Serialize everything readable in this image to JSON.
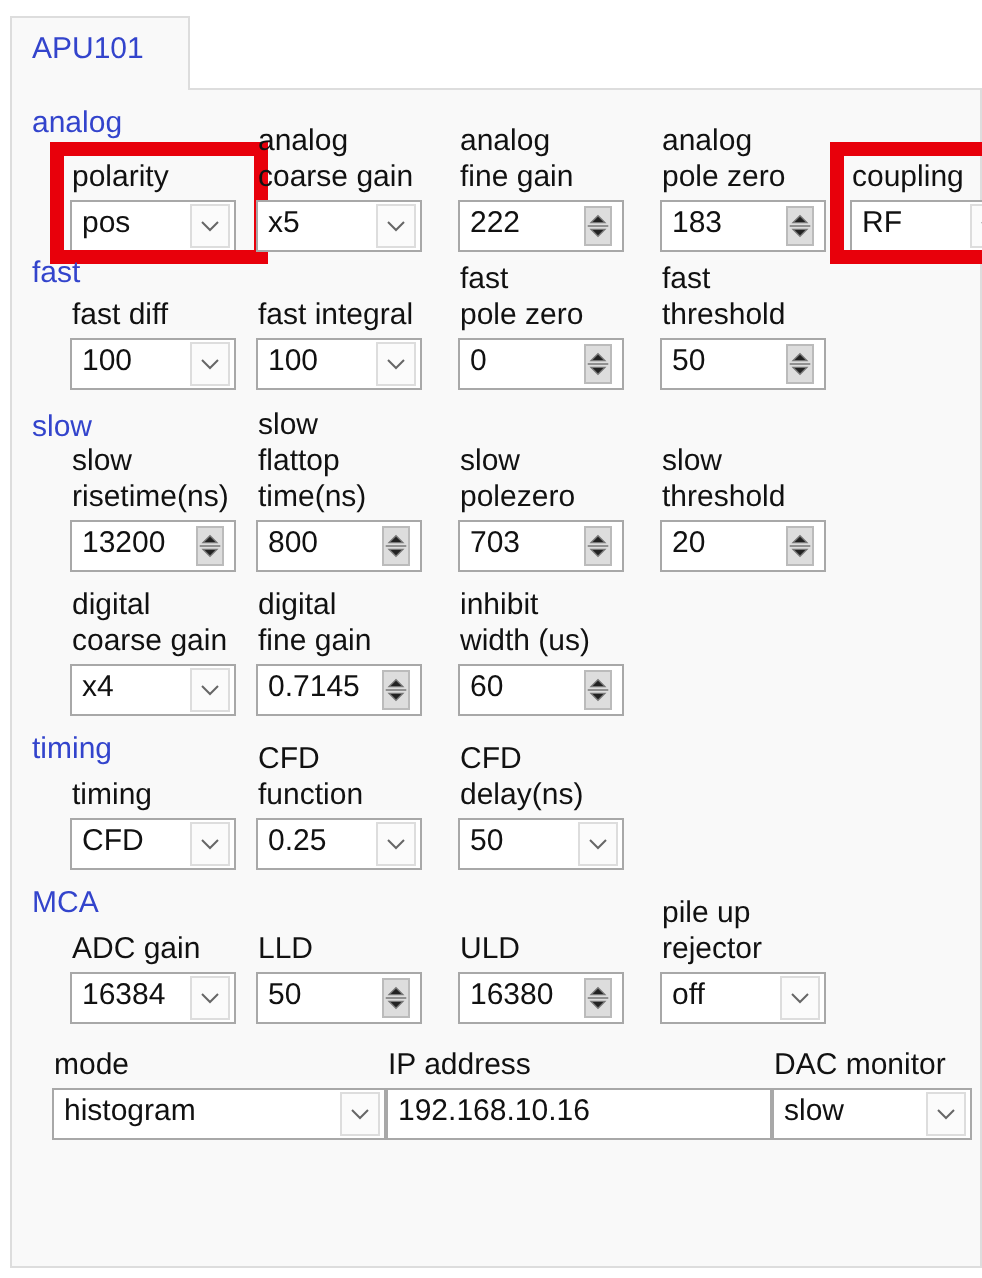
{
  "tabs": [
    {
      "label": "APU101",
      "selected": true
    }
  ],
  "sections": [
    {
      "title": "analog",
      "rows": [
        [
          {
            "label": "polarity",
            "kind": "combo",
            "value": "pos",
            "highlighted": true
          },
          {
            "label": "analog\ncoarse gain",
            "kind": "combo",
            "value": "x5",
            "highlighted": false
          },
          {
            "label": "analog\nfine gain",
            "kind": "spin",
            "value": "222",
            "highlighted": false
          },
          {
            "label": "analog\npole zero",
            "kind": "spin",
            "value": "183",
            "highlighted": false
          },
          {
            "label": "coupling",
            "kind": "combo",
            "value": "RF",
            "highlighted": true
          }
        ]
      ]
    },
    {
      "title": "fast",
      "rows": [
        [
          {
            "label": "fast diff",
            "kind": "combo",
            "value": "100",
            "highlighted": false
          },
          {
            "label": "fast integral",
            "kind": "combo",
            "value": "100",
            "highlighted": false
          },
          {
            "label": "fast\npole zero",
            "kind": "spin",
            "value": "0",
            "highlighted": false
          },
          {
            "label": "fast\nthreshold",
            "kind": "spin",
            "value": "50",
            "highlighted": false
          }
        ]
      ]
    },
    {
      "title": "slow",
      "rows": [
        [
          {
            "label": "slow\nrisetime(ns)",
            "kind": "spin",
            "value": "13200",
            "highlighted": false
          },
          {
            "label": "slow\nflattop\ntime(ns)",
            "kind": "spin",
            "value": "800",
            "highlighted": false
          },
          {
            "label": "slow\npolezero",
            "kind": "spin",
            "value": "703",
            "highlighted": false
          },
          {
            "label": "slow\nthreshold",
            "kind": "spin",
            "value": "20",
            "highlighted": false
          }
        ],
        [
          {
            "label": "digital\ncoarse gain",
            "kind": "combo",
            "value": "x4",
            "highlighted": false
          },
          {
            "label": "digital\nfine gain",
            "kind": "spin",
            "value": "0.7145",
            "highlighted": false
          },
          {
            "label": "inhibit\nwidth (us)",
            "kind": "spin",
            "value": "60",
            "highlighted": false
          }
        ]
      ]
    },
    {
      "title": "timing",
      "rows": [
        [
          {
            "label": "timing",
            "kind": "combo",
            "value": "CFD",
            "highlighted": false
          },
          {
            "label": "CFD\nfunction",
            "kind": "combo",
            "value": "0.25",
            "highlighted": false
          },
          {
            "label": "CFD\ndelay(ns)",
            "kind": "combo",
            "value": "50",
            "highlighted": false
          }
        ]
      ]
    },
    {
      "title": "MCA",
      "rows": [
        [
          {
            "label": "ADC gain",
            "kind": "combo",
            "value": "16384",
            "highlighted": false
          },
          {
            "label": "LLD",
            "kind": "spin",
            "value": "50",
            "highlighted": false
          },
          {
            "label": "ULD",
            "kind": "spin",
            "value": "16380",
            "highlighted": false
          },
          {
            "label": "pile up\nrejector",
            "kind": "combo",
            "value": "off",
            "highlighted": false
          }
        ]
      ]
    }
  ],
  "footer": [
    {
      "label": "mode",
      "kind": "combo",
      "value": "histogram",
      "highlighted": false
    },
    {
      "label": "IP address",
      "kind": "text",
      "value": "192.168.10.16",
      "highlighted": false
    },
    {
      "label": "DAC monitor",
      "kind": "combo",
      "value": "slow",
      "highlighted": false
    }
  ]
}
